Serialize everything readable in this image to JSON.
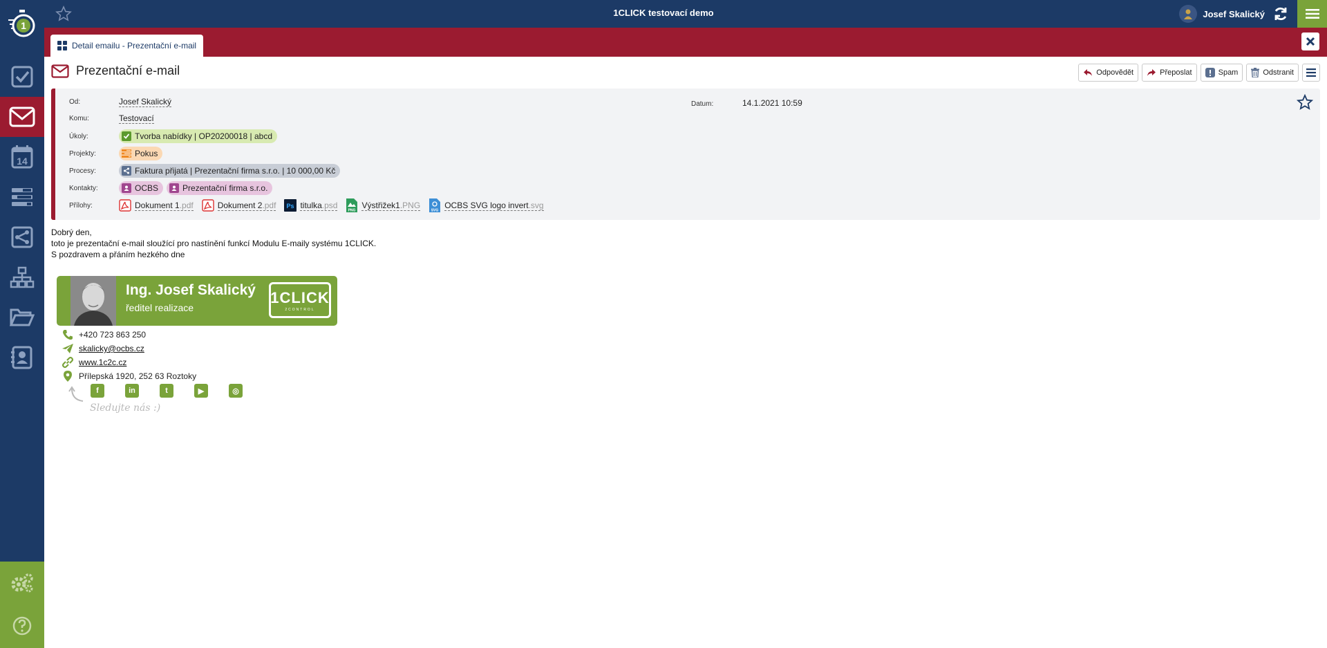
{
  "app": {
    "title": "1CLICK testovací demo",
    "user_name": "Josef Skalický",
    "logo_digit": "1"
  },
  "colors": {
    "navy": "#1c3a66",
    "maroon": "#9b1b30",
    "green": "#7aa33a"
  },
  "sidebar": {
    "items": [
      {
        "name": "tasks-icon"
      },
      {
        "name": "mail-icon",
        "active": true
      },
      {
        "name": "calendar-icon",
        "label": "14"
      },
      {
        "name": "projects-icon"
      },
      {
        "name": "processes-icon"
      },
      {
        "name": "org-chart-icon"
      },
      {
        "name": "folder-icon"
      },
      {
        "name": "contacts-icon"
      }
    ],
    "bottom": [
      {
        "name": "settings-icon"
      },
      {
        "name": "help-icon"
      }
    ]
  },
  "tab": {
    "label": "Detail emailu - Prezentační e-mail"
  },
  "email": {
    "subject": "Prezentační e-mail",
    "actions": {
      "reply": "Odpovědět",
      "forward": "Přeposlat",
      "spam": "Spam",
      "delete": "Odstranit"
    },
    "labels": {
      "from": "Od:",
      "to": "Komu:",
      "tasks": "Úkoly:",
      "projects": "Projekty:",
      "processes": "Procesy:",
      "contacts": "Kontakty:",
      "attachments": "Přílohy:",
      "date": "Datum:"
    },
    "from": "Josef Skalický",
    "to": "Testovací",
    "date": "14.1.2021 10:59",
    "tasks": [
      "Tvorba nabídky | OP20200018 | abcd"
    ],
    "projects": [
      "Pokus"
    ],
    "processes": [
      "Faktura přijatá | Prezentační firma s.r.o. | 10 000,00 Kč"
    ],
    "contacts": [
      "OCBS",
      "Prezentační firma s.r.o."
    ],
    "attachments": [
      {
        "name": "Dokument 1",
        "ext": ".pdf",
        "icon": "pdf-icon"
      },
      {
        "name": "Dokument 2",
        "ext": ".pdf",
        "icon": "pdf-icon"
      },
      {
        "name": "titulka",
        "ext": ".psd",
        "icon": "psd-icon"
      },
      {
        "name": "Výstřižek1",
        "ext": ".PNG",
        "icon": "png-icon"
      },
      {
        "name": "OCBS SVG logo invert",
        "ext": ".svg",
        "icon": "svg-icon"
      }
    ],
    "body": [
      "Dobrý den,",
      "toto je prezentační e-mail sloužící pro nastínění funkcí Modulu E-maily systému 1CLICK.",
      "S pozdravem a přáním hezkého dne"
    ],
    "signature": {
      "name": "Ing. Josef Skalický",
      "role": "ředitel realizace",
      "logo_big": "1CLICK",
      "logo_small": "2CONTROL",
      "phone": "+420 723 863 250",
      "email": "skalicky@ocbs.cz",
      "web": "www.1c2c.cz",
      "address": "Přílepská 1920, 252 63 Roztoky",
      "social": [
        {
          "name": "facebook-icon",
          "glyph": "f"
        },
        {
          "name": "linkedin-icon",
          "glyph": "in"
        },
        {
          "name": "twitter-icon",
          "glyph": "t"
        },
        {
          "name": "youtube-icon",
          "glyph": "▶"
        },
        {
          "name": "instagram-icon",
          "glyph": "◎"
        }
      ],
      "follow": "Sledujte nás :)"
    }
  }
}
